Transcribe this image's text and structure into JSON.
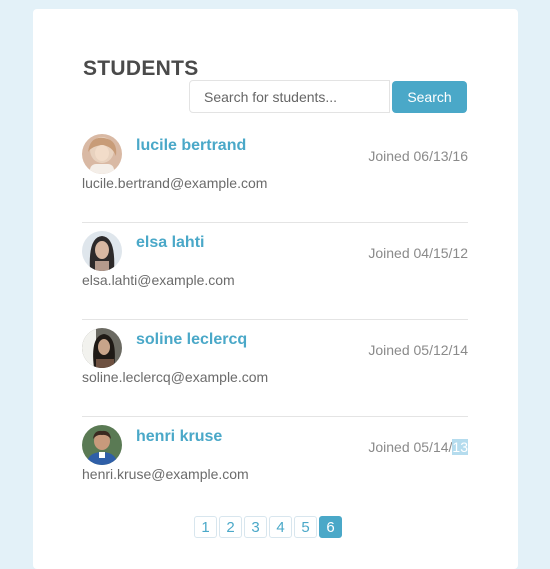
{
  "header": {
    "title": "STUDENTS"
  },
  "search": {
    "placeholder": "Search for students...",
    "value": "",
    "button_label": "Search"
  },
  "students": [
    {
      "name": "lucile bertrand",
      "email": "lucile.bertrand@example.com",
      "joined_prefix": "Joined 06/13/16",
      "joined_selected": ""
    },
    {
      "name": "elsa lahti",
      "email": "elsa.lahti@example.com",
      "joined_prefix": "Joined 04/15/12",
      "joined_selected": ""
    },
    {
      "name": "soline leclercq",
      "email": "soline.leclercq@example.com",
      "joined_prefix": "Joined 05/12/14",
      "joined_selected": ""
    },
    {
      "name": "henri kruse",
      "email": "henri.kruse@example.com",
      "joined_prefix": "Joined 05/14/",
      "joined_selected": "13"
    }
  ],
  "pagination": {
    "pages": [
      "1",
      "2",
      "3",
      "4",
      "5",
      "6"
    ],
    "active": "6"
  },
  "colors": {
    "accent": "#4aa8c8",
    "background": "#e3f1f8",
    "text_selection": "#b5dcee"
  }
}
